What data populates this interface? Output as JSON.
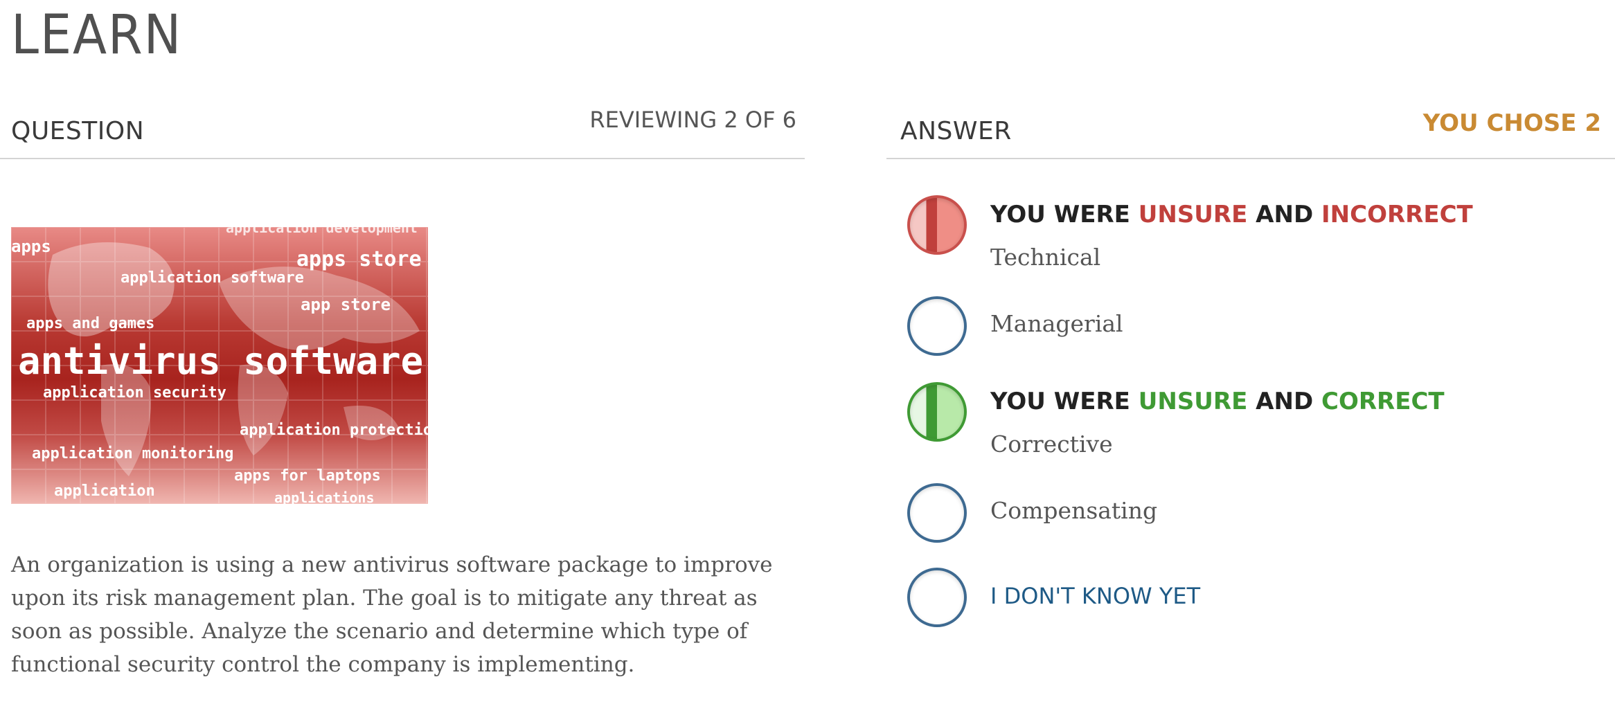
{
  "page": {
    "title": "LEARN"
  },
  "question_panel": {
    "heading": "QUESTION",
    "progress": "REVIEWING 2 OF 6",
    "image_words": {
      "main": "antivirus software",
      "tags": [
        "apps",
        "application software",
        "apps store",
        "app store",
        "apps and games",
        "application security",
        "application protection",
        "application monitoring",
        "apps for laptops",
        "application",
        "applications",
        "application development"
      ]
    },
    "text": "An organization is using a new antivirus software package to improve upon its risk management plan. The goal is to mitigate any threat as soon as possible. Analyze the scenario and determine which type of functional security control the company is implementing."
  },
  "answer_panel": {
    "heading": "ANSWER",
    "choice_summary": "YOU CHOSE 2",
    "status_words": {
      "prefix": "YOU WERE",
      "unsure": "UNSURE",
      "and": "AND",
      "incorrect": "INCORRECT",
      "correct": "CORRECT"
    },
    "options": [
      {
        "label": "Technical",
        "state": "unsure-incorrect"
      },
      {
        "label": "Managerial",
        "state": "none"
      },
      {
        "label": "Corrective",
        "state": "unsure-correct"
      },
      {
        "label": "Compensating",
        "state": "none"
      }
    ],
    "dont_know": "I DON'T KNOW YET"
  },
  "colors": {
    "accent_orange": "#c98a33",
    "incorrect_red": "#c0403c",
    "correct_green": "#3f9a34",
    "radio_blue": "#3e6a91",
    "link_blue": "#1e5a86"
  },
  "icons": {
    "radio_incorrect": "half-filled-red-radio-icon",
    "radio_correct": "half-filled-green-radio-icon",
    "radio_empty": "empty-radio-icon"
  }
}
